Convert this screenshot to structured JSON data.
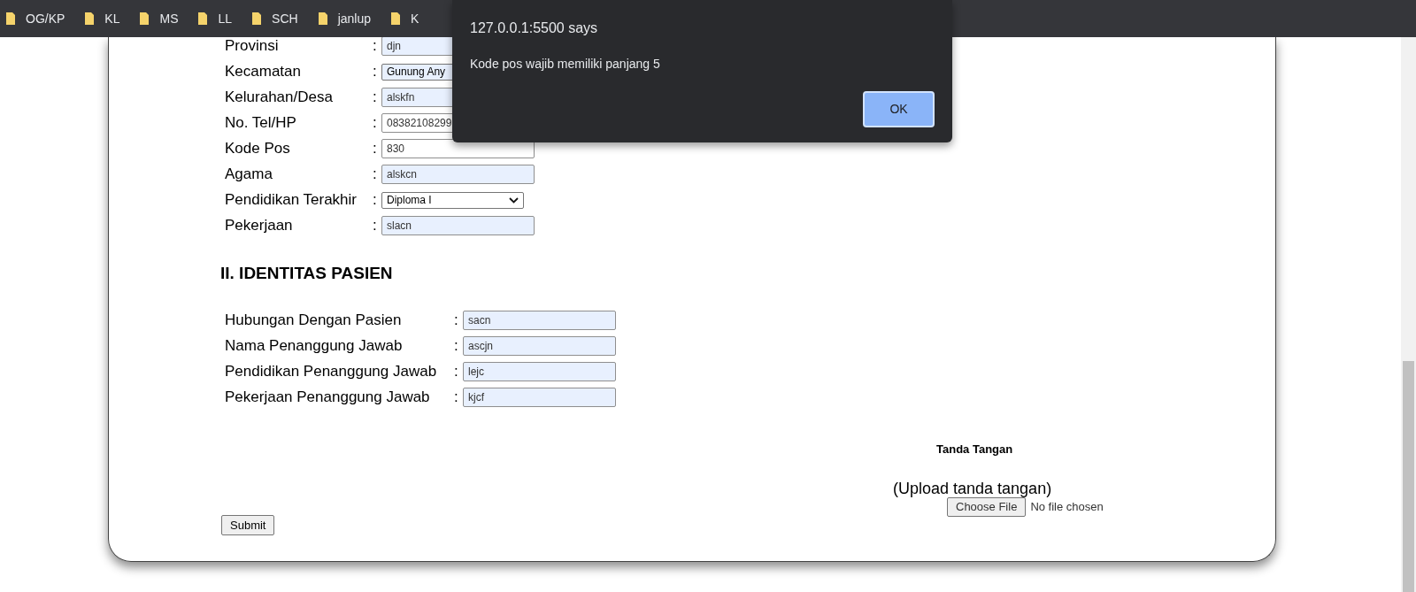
{
  "bookmarks": [
    {
      "label": "OG/KP"
    },
    {
      "label": "KL"
    },
    {
      "label": "MS"
    },
    {
      "label": "LL"
    },
    {
      "label": "SCH"
    },
    {
      "label": "janlup"
    },
    {
      "label": "K"
    }
  ],
  "form": {
    "fields": [
      {
        "label": "Provinsi",
        "colon": ":",
        "kind": "text",
        "value": "djn",
        "autofilled": true
      },
      {
        "label": "Kecamatan",
        "colon": ":",
        "kind": "select",
        "value": "Gunung Any",
        "autofilled": true,
        "covered_by_dialog": true
      },
      {
        "label": "Kelurahan/Desa",
        "colon": ":",
        "kind": "text",
        "value": "alskfn",
        "autofilled": true
      },
      {
        "label": "No. Tel/HP",
        "colon": ":",
        "kind": "text",
        "value": "08382108299",
        "autofilled": false
      },
      {
        "label": "Kode Pos",
        "colon": ":",
        "kind": "text",
        "value": "830",
        "autofilled": false
      },
      {
        "label": "Agama",
        "colon": ":",
        "kind": "text",
        "value": "alskcn",
        "autofilled": true
      },
      {
        "label": "Pendidikan Terakhir",
        "colon": ":",
        "kind": "select",
        "value": "Diploma I",
        "autofilled": false
      },
      {
        "label": "Pekerjaan",
        "colon": ":",
        "kind": "text",
        "value": "slacn",
        "autofilled": true
      }
    ],
    "section_heading": "II. IDENTITAS PASIEN",
    "patient_fields": [
      {
        "label": "Hubungan Dengan Pasien",
        "colon": ":",
        "value": "sacn",
        "autofilled": true
      },
      {
        "label": "Nama Penanggung Jawab",
        "colon": ":",
        "value": "ascjn",
        "autofilled": true
      },
      {
        "label": "Pendidikan Penanggung Jawab",
        "colon": ":",
        "value": "lejc",
        "autofilled": true
      },
      {
        "label": "Pekerjaan Penanggung Jawab",
        "colon": ":",
        "value": "kjcf",
        "autofilled": true
      }
    ],
    "signature": {
      "heading": "Tanda Tangan",
      "upload_label": "(Upload tanda tangan)",
      "file_button": "Choose File",
      "file_status": "No file chosen"
    },
    "submit": "Submit"
  },
  "dialog": {
    "title": "127.0.0.1:5500 says",
    "message": "Kode pos wajib memiliki panjang 5",
    "button": "OK"
  }
}
